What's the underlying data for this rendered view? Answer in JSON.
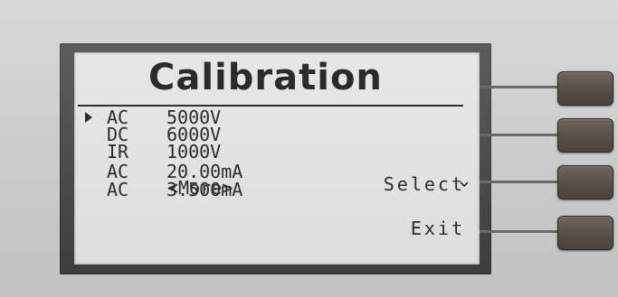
{
  "screen": {
    "title": "Calibration",
    "cursor_icon": "triangle-right-icon",
    "items": [
      {
        "mode": "AC",
        "value": "5000V",
        "selected": true
      },
      {
        "mode": "DC",
        "value": "6000V",
        "selected": false
      },
      {
        "mode": "IR",
        "value": "1000V",
        "selected": false
      },
      {
        "mode": "AC",
        "value": "20.00mA",
        "selected": false
      },
      {
        "mode": "AC",
        "value": "3.500mA",
        "selected": false
      }
    ],
    "more": "<More>"
  },
  "softkeys": {
    "key1_label": "",
    "key2_icon": "chevron-down-icon",
    "key3_label": "Select",
    "key4_label": "Exit"
  },
  "colors": {
    "lcd_background": "#e2e2e2",
    "lcd_text": "#2b2b2b",
    "panel": "#cfcfcf",
    "key": "#5a5147"
  }
}
